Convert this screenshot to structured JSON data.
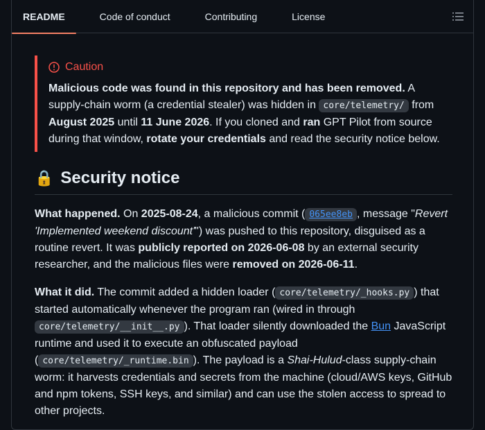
{
  "tabs": {
    "readme": "README",
    "code_of_conduct": "Code of conduct",
    "contributing": "Contributing",
    "license": "License"
  },
  "callout": {
    "title": "Caution",
    "bold1": "Malicious code was found in this repository and has been removed.",
    "t1": " A supply-chain worm (a credential stealer) was hidden in ",
    "code1": "core/telemetry/",
    "t2": " from ",
    "bold2": "August 2025",
    "t3": " until ",
    "bold3": "11 June 2026",
    "t4": ". If you cloned and ",
    "bold4": "ran",
    "t5": " GPT Pilot from source during that window, ",
    "bold5": "rotate your credentials",
    "t6": " and read the security notice below."
  },
  "section": {
    "emoji": "🔒",
    "heading": "Security notice"
  },
  "what_happened": {
    "label": "What happened.",
    "t1": " On ",
    "date": "2025-08-24",
    "t2": ", a malicious commit (",
    "commit": "065ee8eb",
    "t3": ", message \"",
    "message": "Revert 'Implemented weekend discount'",
    "t4": "\") was pushed to this repository, disguised as a routine revert. It was ",
    "bold_reported": "publicly reported on 2026-06-08",
    "t5": " by an external security researcher, and the malicious files were ",
    "bold_removed": "removed on 2026-06-11",
    "t6": "."
  },
  "what_it_did": {
    "label": "What it did.",
    "t1": " The commit added a hidden loader (",
    "code1": "core/telemetry/_hooks.py",
    "t2": ") that started automatically whenever the program ran (wired in through ",
    "code2": "core/telemetry/__init__.py",
    "t3": "). That loader silently downloaded the ",
    "link": "Bun",
    "t4": " JavaScript runtime and used it to execute an obfuscated payload (",
    "code3": "core/telemetry/_runtime.bin",
    "t5": "). The payload is a ",
    "italic": "Shai-Hulud",
    "t6": "-class supply-chain worm: it harvests credentials and secrets from the machine (cloud/AWS keys, GitHub and npm tokens, SSH keys, and similar) and can use the stolen access to spread to other projects."
  },
  "colors": {
    "caution": "#f85149",
    "active_tab_underline": "#f78166",
    "link": "#4493f8"
  },
  "icons": {
    "caution": "alert-circle-icon",
    "toc": "list-unordered-icon"
  }
}
